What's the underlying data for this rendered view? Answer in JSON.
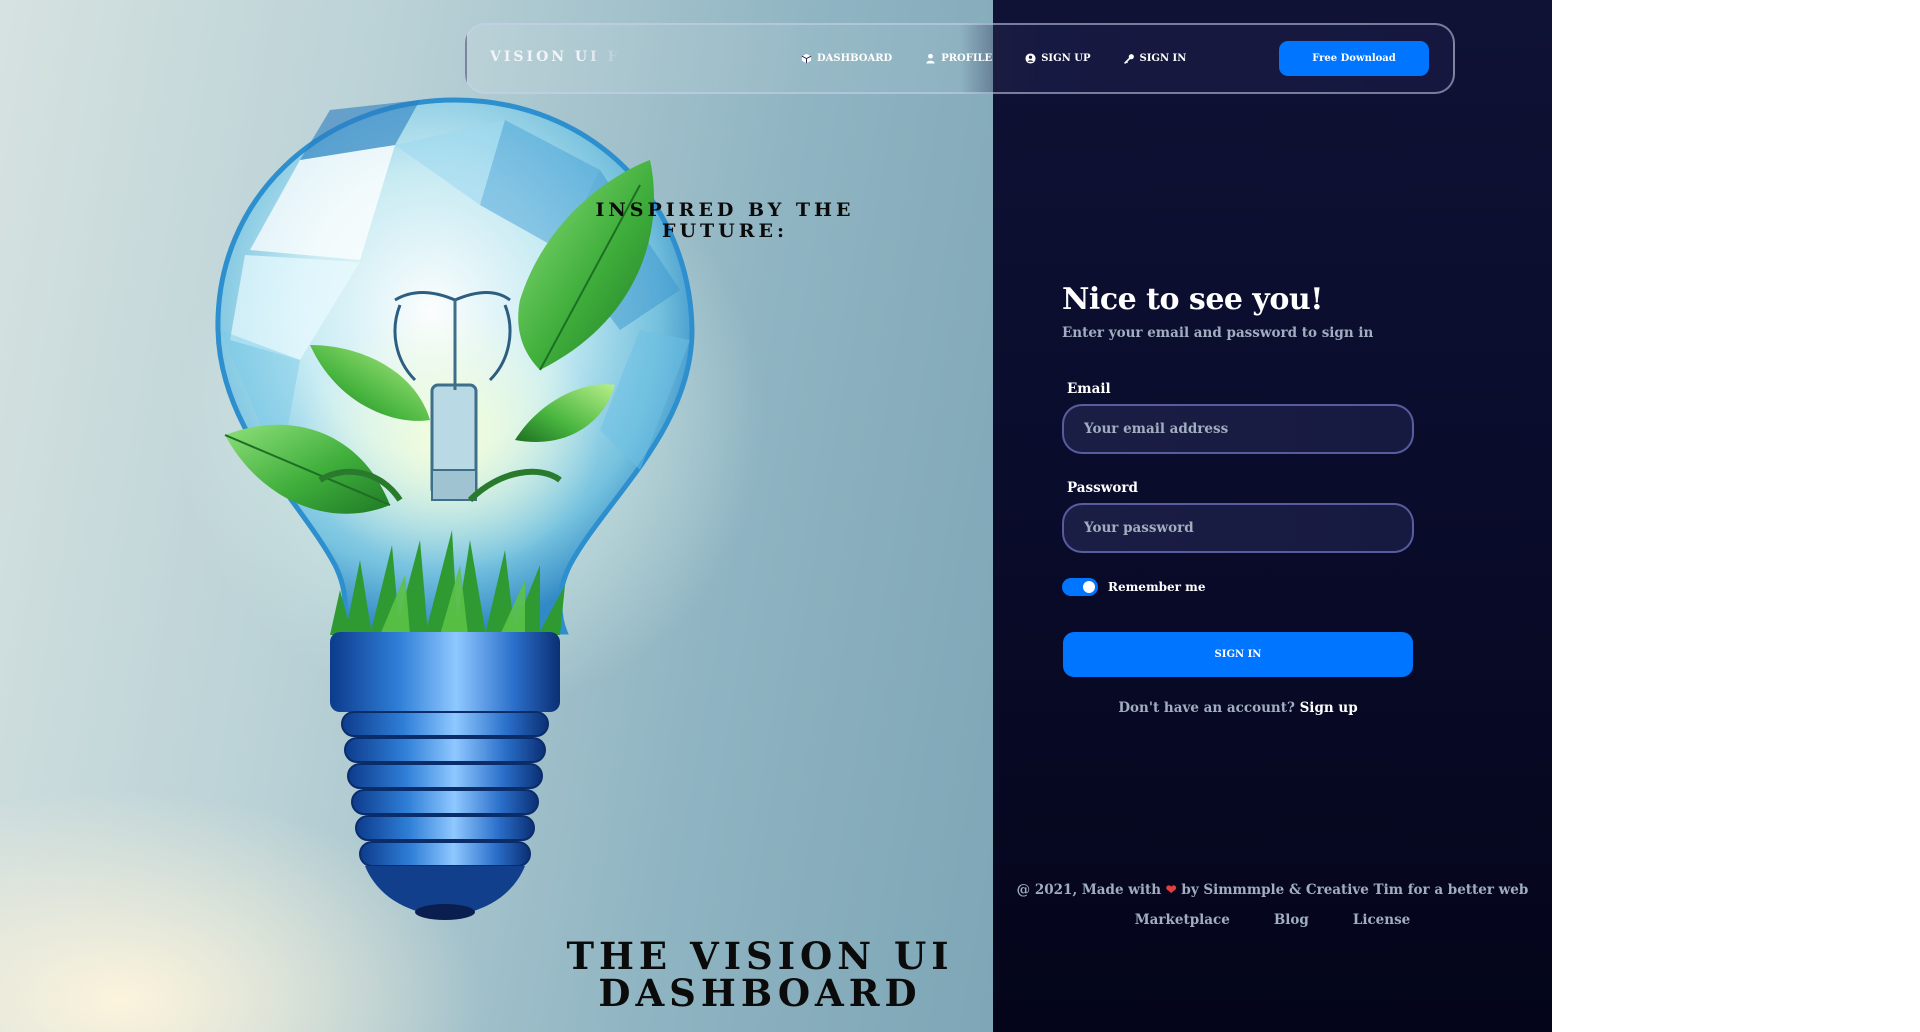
{
  "brand": {
    "name": "VISION UI FREE"
  },
  "nav": {
    "items": [
      {
        "label": "DASHBOARD",
        "icon": "cube-icon"
      },
      {
        "label": "PROFILE",
        "icon": "user-icon"
      },
      {
        "label": "SIGN UP",
        "icon": "user-circle-icon"
      },
      {
        "label": "SIGN IN",
        "icon": "key-icon"
      }
    ],
    "download_label": "Free Download"
  },
  "hero": {
    "tagline": "INSPIRED BY THE FUTURE:",
    "title": "THE VISION UI DASHBOARD",
    "illustration": "lightbulb-with-plants-icon"
  },
  "form": {
    "title": "Nice to see you!",
    "subtitle": "Enter your email and password to sign in",
    "email_label": "Email",
    "email_placeholder": "Your email address",
    "password_label": "Password",
    "password_placeholder": "Your password",
    "remember_label": "Remember me",
    "remember_checked": true,
    "submit_label": "SIGN IN",
    "signup_prompt": "Don't have an account?",
    "signup_link": "Sign up"
  },
  "footer": {
    "prefix": "@ 2021, Made with",
    "suffix": "by Simmmple & Creative Tim for a better web",
    "links": [
      "Marketplace",
      "Blog",
      "License"
    ]
  },
  "colors": {
    "accent": "#0075ff",
    "panel_dark": "#0a0c2c",
    "muted_text": "#a0aec0",
    "heart": "#e53e3e"
  }
}
